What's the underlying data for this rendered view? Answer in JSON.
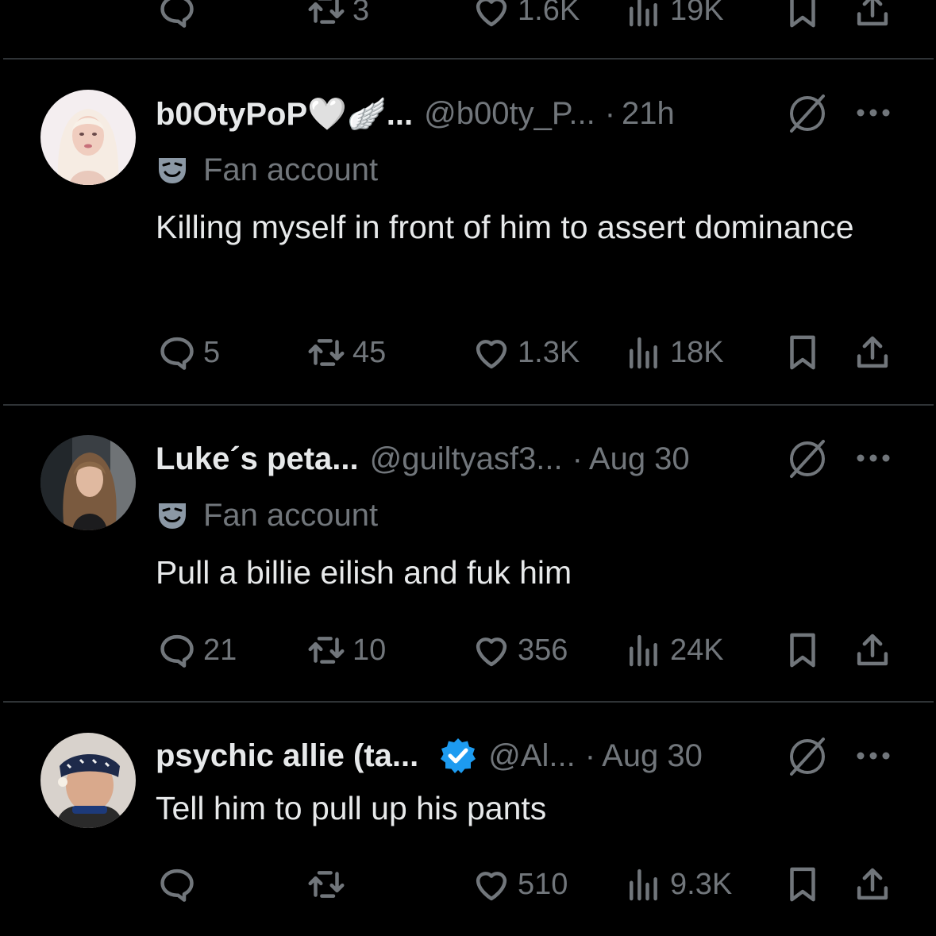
{
  "top_partial": {
    "reply_count": "",
    "repost_count": "3",
    "like_count": "1.6K",
    "view_count": "19K"
  },
  "tweets": [
    {
      "display_name": "b0OtyPoP🤍🪽...",
      "handle": "@b00ty_P...",
      "separator": "·",
      "time": "21h",
      "label": "Fan account",
      "text": "Killing myself in front of him to assert dominance",
      "reply_count": "5",
      "repost_count": "45",
      "like_count": "1.3K",
      "view_count": "18K"
    },
    {
      "display_name": "Luke´s peta...",
      "handle": "@guiltyasf3...",
      "separator": "·",
      "time": "Aug 30",
      "label": "Fan account",
      "text": "Pull a billie eilish and fuk him",
      "reply_count": "21",
      "repost_count": "10",
      "like_count": "356",
      "view_count": "24K"
    },
    {
      "display_name": "psychic allie (ta...",
      "handle": "@Al...",
      "separator": "·",
      "time": "Aug 30",
      "verified": true,
      "text": "Tell him to pull up his pants",
      "reply_count": "",
      "repost_count": "",
      "like_count": "510",
      "view_count": "9.3K"
    }
  ],
  "colors": {
    "background": "#000000",
    "primary_text": "#e7e9ea",
    "secondary_text": "#71767b",
    "divider": "#2f3336",
    "verified_badge": "#1d9bf0"
  },
  "icons": [
    "reply-icon",
    "repost-icon",
    "like-icon",
    "views-icon",
    "bookmark-icon",
    "share-icon",
    "block-icon",
    "more-icon",
    "fan-account-mask-icon",
    "verified-badge-icon"
  ]
}
